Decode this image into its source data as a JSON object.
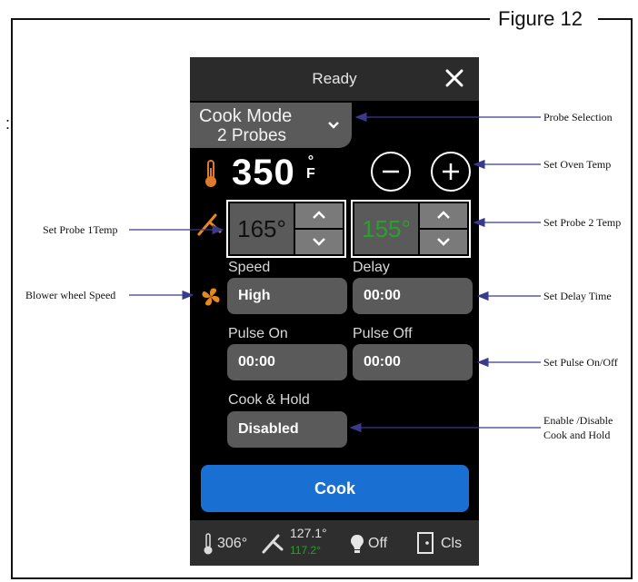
{
  "figure_title": "Figure 12",
  "edge_mark": ":",
  "screen": {
    "header_title": "Ready",
    "close_icon": "close-icon",
    "cook_mode_line1": "Cook Mode",
    "cook_mode_line2": "2 Probes",
    "oven_temp": "350",
    "oven_unit_deg": "°",
    "oven_unit_f": "F",
    "probe1_value": "165°",
    "probe1_color": "#111111",
    "probe2_value": "155°",
    "probe2_color": "#2ca02c",
    "speed_label": "Speed",
    "speed_value": "High",
    "delay_label": "Delay",
    "delay_value": "00:00",
    "pulse_on_label": "Pulse On",
    "pulse_on_value": "00:00",
    "pulse_off_label": "Pulse Off",
    "pulse_off_value": "00:00",
    "cook_hold_label": "Cook & Hold",
    "cook_hold_value": "Disabled",
    "cook_button": "Cook",
    "cook_button_color": "#1a6fd2",
    "status": {
      "oven_temp": "306°",
      "probe1": "127.1°",
      "probe2": "117.2°",
      "light": "Off",
      "door": "Cls"
    }
  },
  "annotations": {
    "probe_selection": "Probe Selection",
    "set_oven_temp": "Set Oven Temp",
    "set_probe1": "Set Probe 1Temp",
    "set_probe2": "Set Probe 2 Temp",
    "blower": "Blower wheel Speed",
    "set_delay": "Set Delay Time",
    "set_pulse": "Set Pulse On/Off",
    "enable_l1": "Enable /Disable",
    "enable_l2": "Cook and Hold"
  },
  "colors": {
    "arrow": "#3a3a8c",
    "fan": "#e8891a",
    "thermometer": "#e07a2a"
  }
}
